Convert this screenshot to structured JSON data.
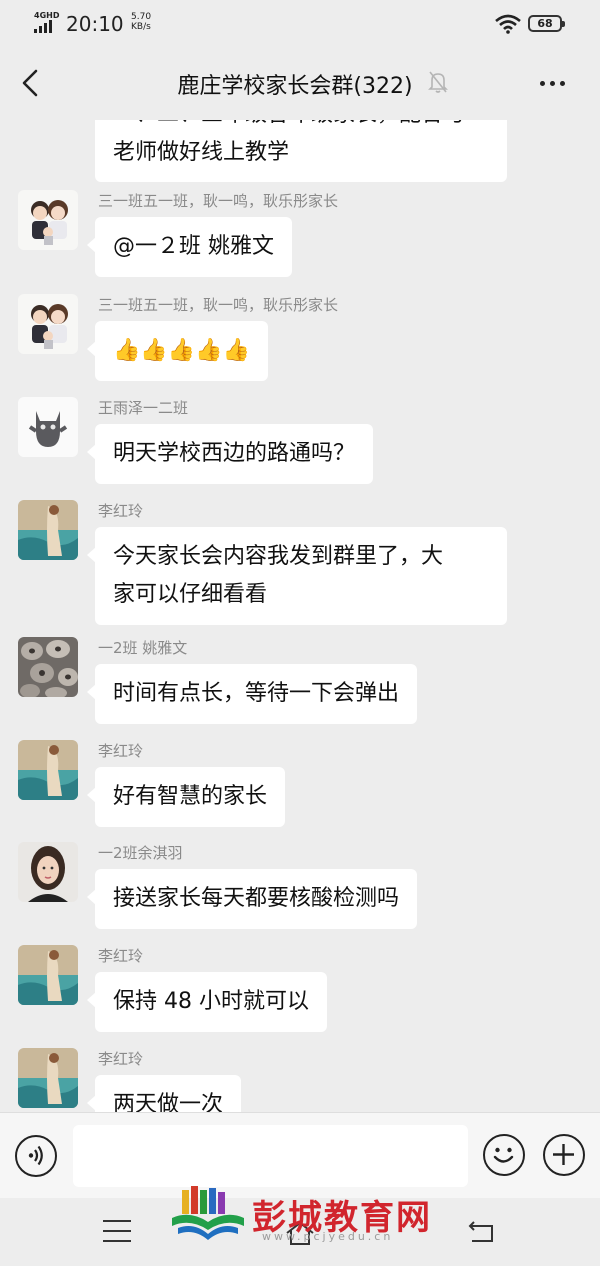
{
  "status_bar": {
    "network": "4GHD",
    "time": "20:10",
    "speed_value": "5.70",
    "speed_unit": "KB/s",
    "battery": "68",
    "icons": [
      "signal-icon",
      "wifi-icon",
      "battery-icon"
    ]
  },
  "header": {
    "title": "鹿庄学校家长会群(322)",
    "icons": [
      "back-arrow-icon",
      "mute-bell-icon",
      "more-icon"
    ]
  },
  "messages": [
    {
      "sender": "",
      "lines": [
        "一、二、三年级各年级家长，配合与",
        "老师做好线上教学"
      ],
      "avatar": ""
    },
    {
      "sender": "三一班五一班，耿一鸣，耿乐彤家长",
      "lines": [
        "@一２班 姚雅文"
      ],
      "avatar": "cartoon-couple-avatar"
    },
    {
      "sender": "三一班五一班，耿一鸣，耿乐彤家长",
      "lines": [
        "👍👍👍👍👍"
      ],
      "avatar": "cartoon-couple-avatar"
    },
    {
      "sender": "王雨泽一二班",
      "lines": [
        "明天学校西边的路通吗？"
      ],
      "avatar": "gray-cat-avatar"
    },
    {
      "sender": "李红玲",
      "lines": [
        "今天家长会内容我发到群里了，大",
        "家可以仔细看看"
      ],
      "avatar": "painting-avatar"
    },
    {
      "sender": "一2班 姚雅文",
      "lines": [
        "时间有点长，等待一下会弹出"
      ],
      "avatar": "stones-avatar"
    },
    {
      "sender": "李红玲",
      "lines": [
        "好有智慧的家长"
      ],
      "avatar": "painting-avatar"
    },
    {
      "sender": "一2班余淇羽",
      "lines": [
        "接送家长每天都要核酸检测吗"
      ],
      "avatar": "woman-portrait-avatar"
    },
    {
      "sender": "李红玲",
      "lines": [
        "保持 48 小时就可以"
      ],
      "avatar": "painting-avatar"
    },
    {
      "sender": "李红玲",
      "lines": [
        "两天做一次"
      ],
      "avatar": "painting-avatar"
    }
  ],
  "input_bar": {
    "text_value": "",
    "icons": [
      "voice-icon",
      "emoji-icon",
      "plus-icon"
    ]
  },
  "watermark": {
    "name": "彭城教育网",
    "url": "www.pcjyedu.cn"
  },
  "system_nav": {
    "icons": [
      "menu-icon",
      "home-icon",
      "back-icon"
    ]
  }
}
